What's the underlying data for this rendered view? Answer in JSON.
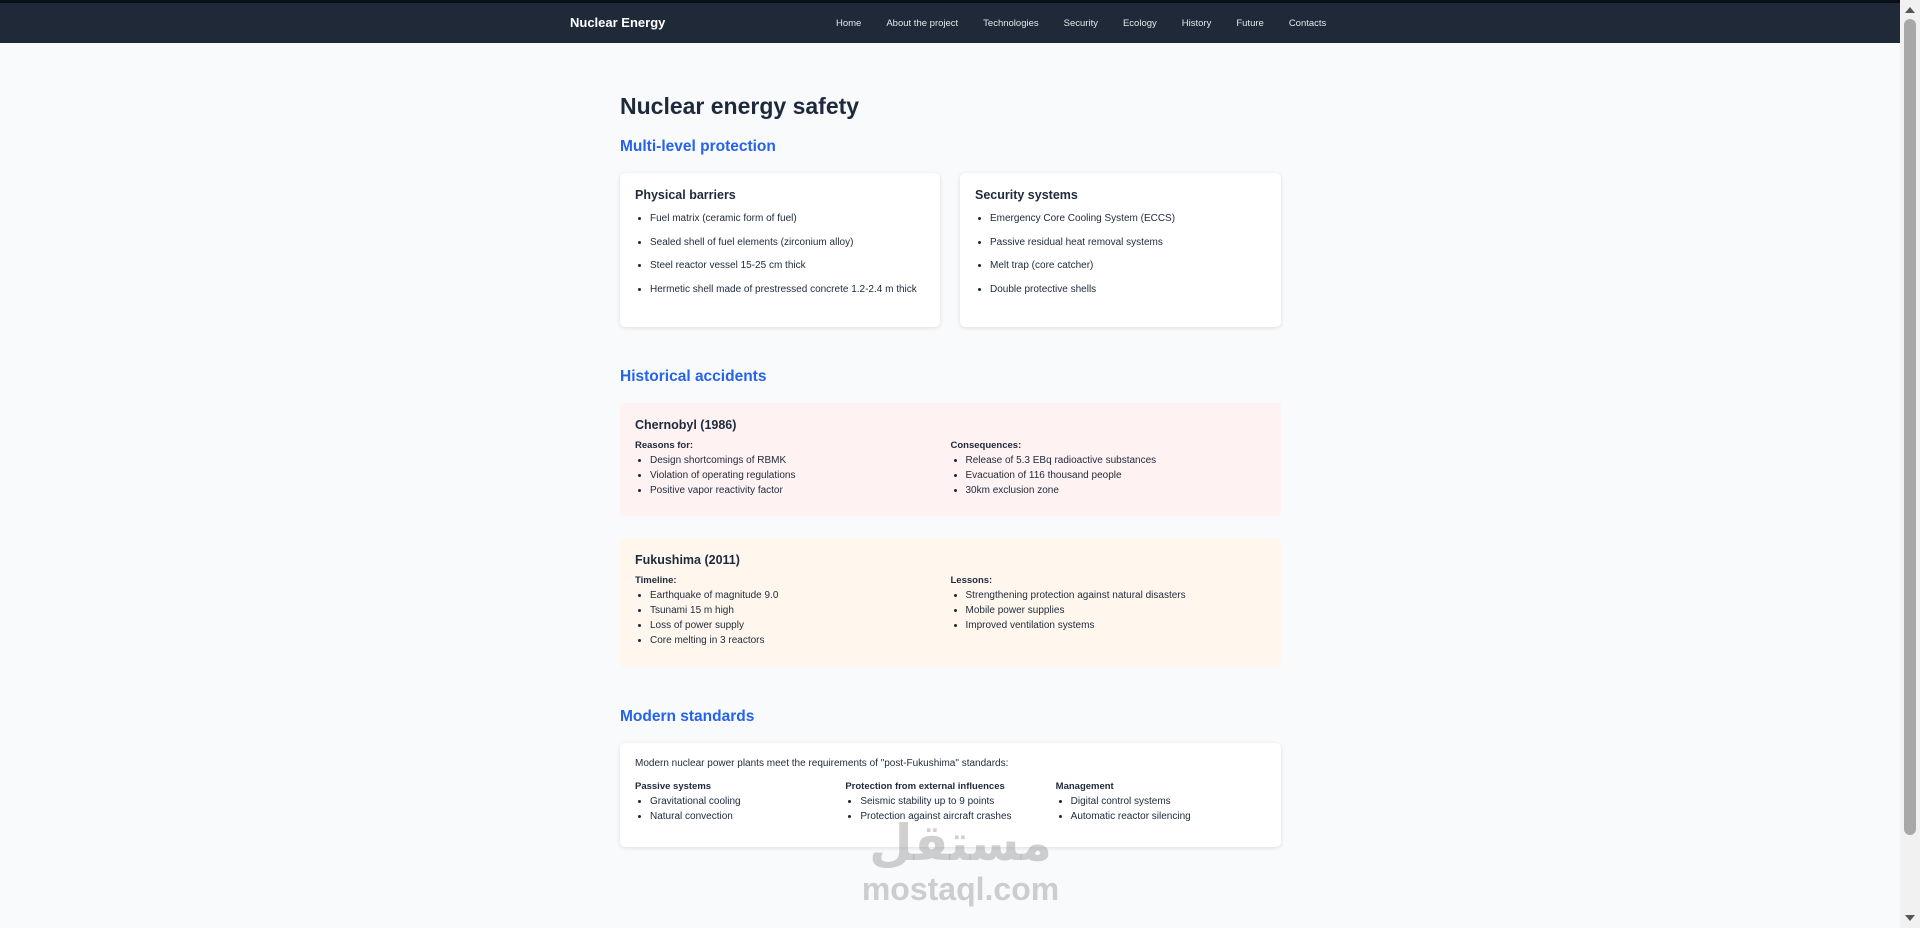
{
  "nav": {
    "brand": "Nuclear Energy",
    "links": [
      "Home",
      "About the project",
      "Technologies",
      "Security",
      "Ecology",
      "History",
      "Future",
      "Contacts"
    ]
  },
  "page": {
    "title": "Nuclear energy safety"
  },
  "protection": {
    "heading": "Multi-level protection",
    "physical": {
      "title": "Physical barriers",
      "items": [
        "Fuel matrix (ceramic form of fuel)",
        "Sealed shell of fuel elements (zirconium alloy)",
        "Steel reactor vessel 15-25 cm thick",
        "Hermetic shell made of prestressed concrete 1.2-2.4 m thick"
      ]
    },
    "systems": {
      "title": "Security systems",
      "items": [
        "Emergency Core Cooling System (ECCS)",
        "Passive residual heat removal systems",
        "Melt trap (core catcher)",
        "Double protective shells"
      ]
    }
  },
  "accidents": {
    "heading": "Historical accidents",
    "chernobyl": {
      "title": "Chernobyl (1986)",
      "left_label": "Reasons for:",
      "left_items": [
        "Design shortcomings of RBMK",
        "Violation of operating regulations",
        "Positive vapor reactivity factor"
      ],
      "right_label": "Consequences:",
      "right_items": [
        "Release of 5.3 EBq radioactive substances",
        "Evacuation of 116 thousand people",
        "30km exclusion zone"
      ],
      "bg_color": "#fef2f2"
    },
    "fukushima": {
      "title": "Fukushima (2011)",
      "left_label": "Timeline:",
      "left_items": [
        "Earthquake of magnitude 9.0",
        "Tsunami 15 m high",
        "Loss of power supply",
        "Core melting in 3 reactors"
      ],
      "right_label": "Lessons:",
      "right_items": [
        "Strengthening protection against natural disasters",
        "Mobile power supplies",
        "Improved ventilation systems"
      ],
      "bg_color": "#fff7ed"
    }
  },
  "standards": {
    "heading": "Modern standards",
    "intro": "Modern nuclear power plants meet the requirements of \"post-Fukushima\" standards:",
    "columns": [
      {
        "label": "Passive systems",
        "items": [
          "Gravitational cooling",
          "Natural convection"
        ]
      },
      {
        "label": "Protection from external influences",
        "items": [
          "Seismic stability up to 9 points",
          "Protection against aircraft crashes"
        ]
      },
      {
        "label": "Management",
        "items": [
          "Digital control systems",
          "Automatic reactor silencing"
        ]
      }
    ]
  },
  "watermark": {
    "logo": "مستقل",
    "text": "mostaql.com"
  },
  "colors": {
    "navbar": "#1f2937",
    "accent": "#2563eb",
    "page_bg": "#f8fafc"
  }
}
